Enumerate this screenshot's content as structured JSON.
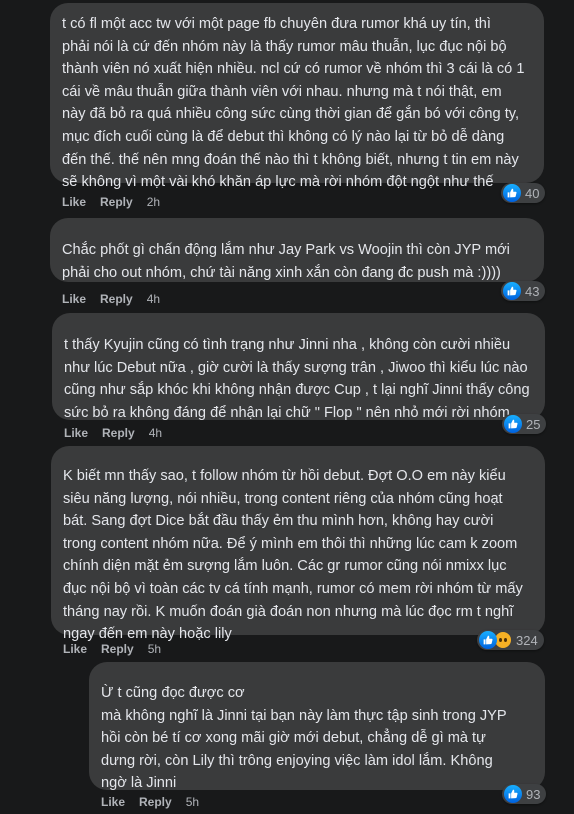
{
  "colors": {
    "background": "#18191a",
    "bubble": "#3a3b3c",
    "text": "#e4e6eb",
    "secondary_text": "#b0b3b8",
    "like_blue": "#0a7cff"
  },
  "comments": [
    {
      "text": "t có fl một acc tw với một page fb chuyên đưa rumor khá uy tín, thì\nphải nói là cứ đến nhóm này là thấy rumor mâu thuẫn, lục đục nội bộ\nthành viên nó xuất hiện nhiều. ncl cứ có rumor về nhóm thì 3 cái là có 1\ncái về mâu thuẫn giữa thành viên với nhau. nhưng mà t nói thật, em\nnày đã bỏ ra quá nhiều công sức cùng thời gian để gắn bó với công ty,\nmục đích cuối cùng là để debut thì không có lý nào lại từ bỏ dễ dàng\nđến thế. thế nên mng đoán thế nào thì t không biết, nhưng t tin em này\nsẽ không vì một vài khó khăn áp lực mà rời nhóm đột ngột như thế",
      "like_label": "Like",
      "reply_label": "Reply",
      "time": "2h",
      "reaction_count": "40",
      "reaction_icons": [
        "like-icon"
      ]
    },
    {
      "text": "Chắc phốt gì chấn động lắm như Jay Park vs Woojin thì còn JYP mới\nphải cho out nhóm, chứ tài năng xinh xắn còn đang đc push mà :))))",
      "like_label": "Like",
      "reply_label": "Reply",
      "time": "4h",
      "reaction_count": "43",
      "reaction_icons": [
        "like-icon"
      ]
    },
    {
      "text": "t thấy Kyujin cũng có tình trạng như Jinni nha , không còn cười nhiều\nnhư lúc Debut nữa , giờ cười là thấy sượng trân , Jiwoo thì kiểu lúc nào\ncũng như sắp khóc khi không nhận được Cup , t lại nghĩ Jinni thấy công\nsức bỏ ra không đáng để nhận lại chữ \" Flop \" nên nhỏ mới rời nhóm",
      "like_label": "Like",
      "reply_label": "Reply",
      "time": "4h",
      "reaction_count": "25",
      "reaction_icons": [
        "like-icon"
      ]
    },
    {
      "text": "K biết mn thấy sao, t follow nhóm từ hồi debut. Đợt O.O em này kiểu\nsiêu năng lượng, nói nhiều, trong content riêng của nhóm cũng hoạt\nbát. Sang đợt Dice bắt đầu thấy ẻm thu mình hơn, không hay cười\ntrong content nhóm nữa. Để ý mình em thôi thì những lúc cam k zoom\nchính diện mặt ẻm sượng lắm luôn. Các gr rumor cũng nói nmixx lục\nđục nội bộ vì toàn các tv cá tính mạnh, rumor có mem rời nhóm từ mấy\ntháng nay rồi. K muốn đoán già đoán non nhưng mà lúc đọc rm t nghĩ\nngay đến em này hoặc lily",
      "like_label": "Like",
      "reply_label": "Reply",
      "time": "5h",
      "reaction_count": "324",
      "reaction_icons": [
        "like-icon",
        "sad-icon"
      ]
    },
    {
      "text": "Ừ t cũng đọc được cơ\nmà không nghĩ là Jinni tại bạn này làm thực tập sinh trong JYP\nhồi còn bé tí cơ xong mãi giờ mới debut, chẳng dễ gì mà tự\ndưng rời, còn Lily thì trông enjoying việc làm idol lắm. Không\nngờ là Jinni",
      "like_label": "Like",
      "reply_label": "Reply",
      "time": "5h",
      "reaction_count": "93",
      "reaction_icons": [
        "like-icon"
      ]
    }
  ]
}
